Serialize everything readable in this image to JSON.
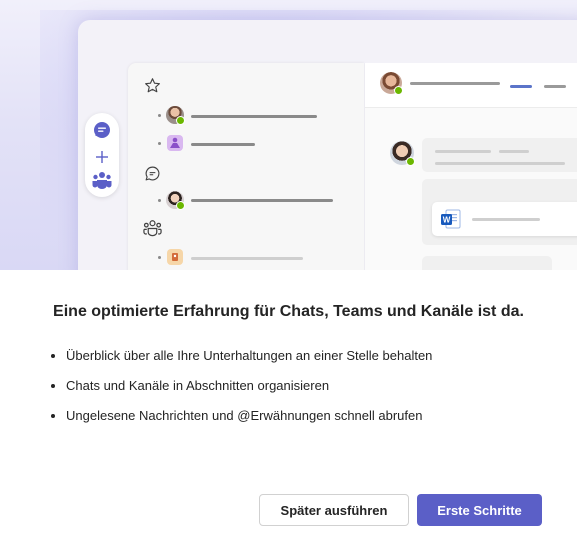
{
  "dialog": {
    "title": "Eine optimierte Erfahrung für Chats, Teams und Kanäle ist da.",
    "bullets": [
      "Überblick über alle Ihre Unterhaltungen an einer Stelle behalten",
      "Chats und Kanäle in Abschnitten organisieren",
      "Ungelesene Nachrichten und @Erwähnungen schnell abrufen"
    ],
    "secondary_button": "Später ausführen",
    "primary_button": "Erste Schritte"
  },
  "illustration": {
    "rail_icons": [
      "chat-icon",
      "plus-icon",
      "teams-icon"
    ],
    "section_icons": [
      "star-icon",
      "chat-bubble-icon",
      "teams-outline-icon"
    ],
    "file_icon": "word-document-icon"
  },
  "colors": {
    "accent": "#5b5fc7",
    "presence": "#6bb700",
    "word_blue": "#185abd"
  }
}
